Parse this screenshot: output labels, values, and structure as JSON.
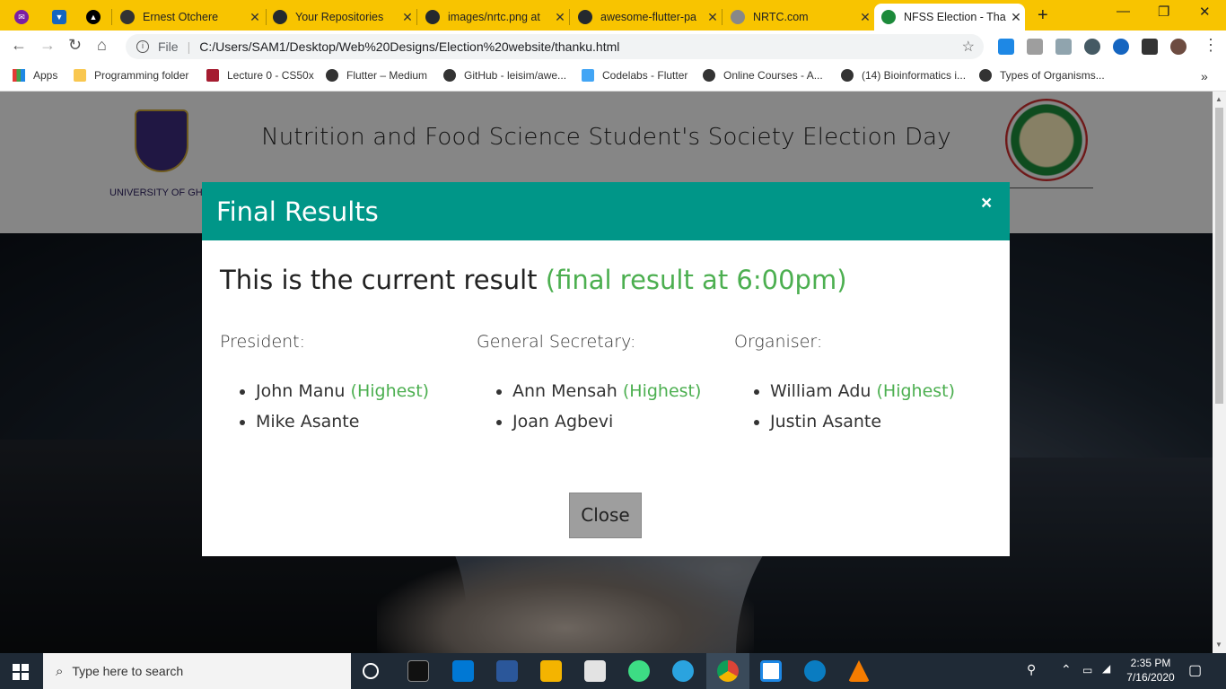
{
  "browser": {
    "tabs": [
      {
        "title": "",
        "color": "#7b1fa2"
      },
      {
        "title": "",
        "color": "#1565c0"
      },
      {
        "title": "",
        "color": "#000000"
      },
      {
        "title": "Ernest Otchere",
        "color": "#333333"
      },
      {
        "title": "Your Repositories",
        "color": "#24292e"
      },
      {
        "title": "images/nrtc.png at",
        "color": "#24292e"
      },
      {
        "title": "awesome-flutter-pa",
        "color": "#24292e"
      },
      {
        "title": "NRTC.com",
        "color": "#888888"
      },
      {
        "title": "NFSS Election - Tha",
        "color": "#1c8a3a"
      }
    ],
    "new_tab": "+",
    "window_controls": {
      "minimize": "—",
      "restore": "❐",
      "close": "✕"
    },
    "nav": {
      "back": "←",
      "forward": "→",
      "reload": "↻",
      "home": "⌂"
    },
    "address": {
      "scheme_label": "File",
      "url": "C:/Users/SAM1/Desktop/Web%20Designs/Election%20website/thanku.html",
      "star": "☆"
    },
    "bookmarks": [
      {
        "label": "Apps"
      },
      {
        "label": "Programming folder"
      },
      {
        "label": "Lecture 0 - CS50x"
      },
      {
        "label": "Flutter – Medium"
      },
      {
        "label": "GitHub - leisim/awe..."
      },
      {
        "label": "Codelabs - Flutter"
      },
      {
        "label": "Online Courses - A..."
      },
      {
        "label": "(14) Bioinformatics i..."
      },
      {
        "label": "Types of Organisms..."
      }
    ],
    "bookmarks_more": "»"
  },
  "site": {
    "title": "Nutrition and Food Science Student's Society Election Day",
    "university_caption": "UNIVERSITY OF GHANA"
  },
  "modal": {
    "title": "Final Results",
    "close_x": "×",
    "lead": "This is the current result",
    "lead_note": "(final result at 6:00pm)",
    "columns": [
      {
        "role": "President:",
        "candidates": [
          {
            "name": "John Manu",
            "tag": "(Highest)"
          },
          {
            "name": "Mike Asante",
            "tag": ""
          }
        ]
      },
      {
        "role": "General Secretary:",
        "candidates": [
          {
            "name": "Ann Mensah",
            "tag": "(Highest)"
          },
          {
            "name": "Joan Agbevi",
            "tag": ""
          }
        ]
      },
      {
        "role": "Organiser:",
        "candidates": [
          {
            "name": "William Adu",
            "tag": "(Highest)"
          },
          {
            "name": "Justin Asante",
            "tag": ""
          }
        ]
      }
    ],
    "close_button": "Close",
    "accent": "#009688",
    "highlight": "#4caf50"
  },
  "taskbar": {
    "search_placeholder": "Type here to search",
    "time": "2:35 PM",
    "date": "7/16/2020"
  }
}
